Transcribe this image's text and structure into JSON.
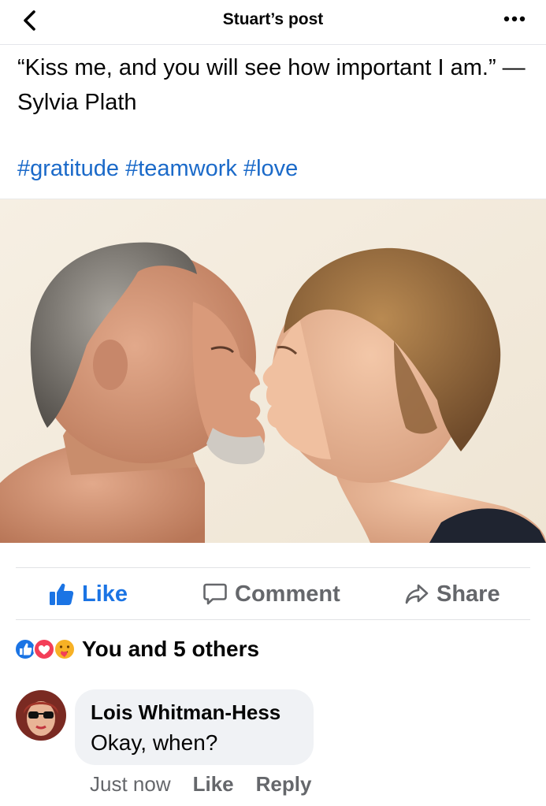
{
  "header": {
    "title": "Stuart’s post"
  },
  "post": {
    "text": "“Kiss me, and you will see how important I am.” — Sylvia Plath",
    "hashtags": [
      "#gratitude",
      "#teamwork",
      "#love"
    ],
    "photo_description": "photo-man-and-woman-kissing"
  },
  "actions": {
    "like": "Like",
    "comment": "Comment",
    "share": "Share"
  },
  "reactions": {
    "icons": [
      "like-reaction-icon",
      "love-reaction-icon",
      "care-reaction-icon"
    ],
    "summary": "You and 5 others"
  },
  "comment": {
    "author": "Lois Whitman-Hess",
    "text": "Okay, when?",
    "time": "Just now",
    "like_label": "Like",
    "reply_label": "Reply"
  },
  "colors": {
    "accent": "#1b74e4",
    "hashtag": "#1b6ac9",
    "muted": "#65676b",
    "bubble": "#f0f2f5"
  }
}
